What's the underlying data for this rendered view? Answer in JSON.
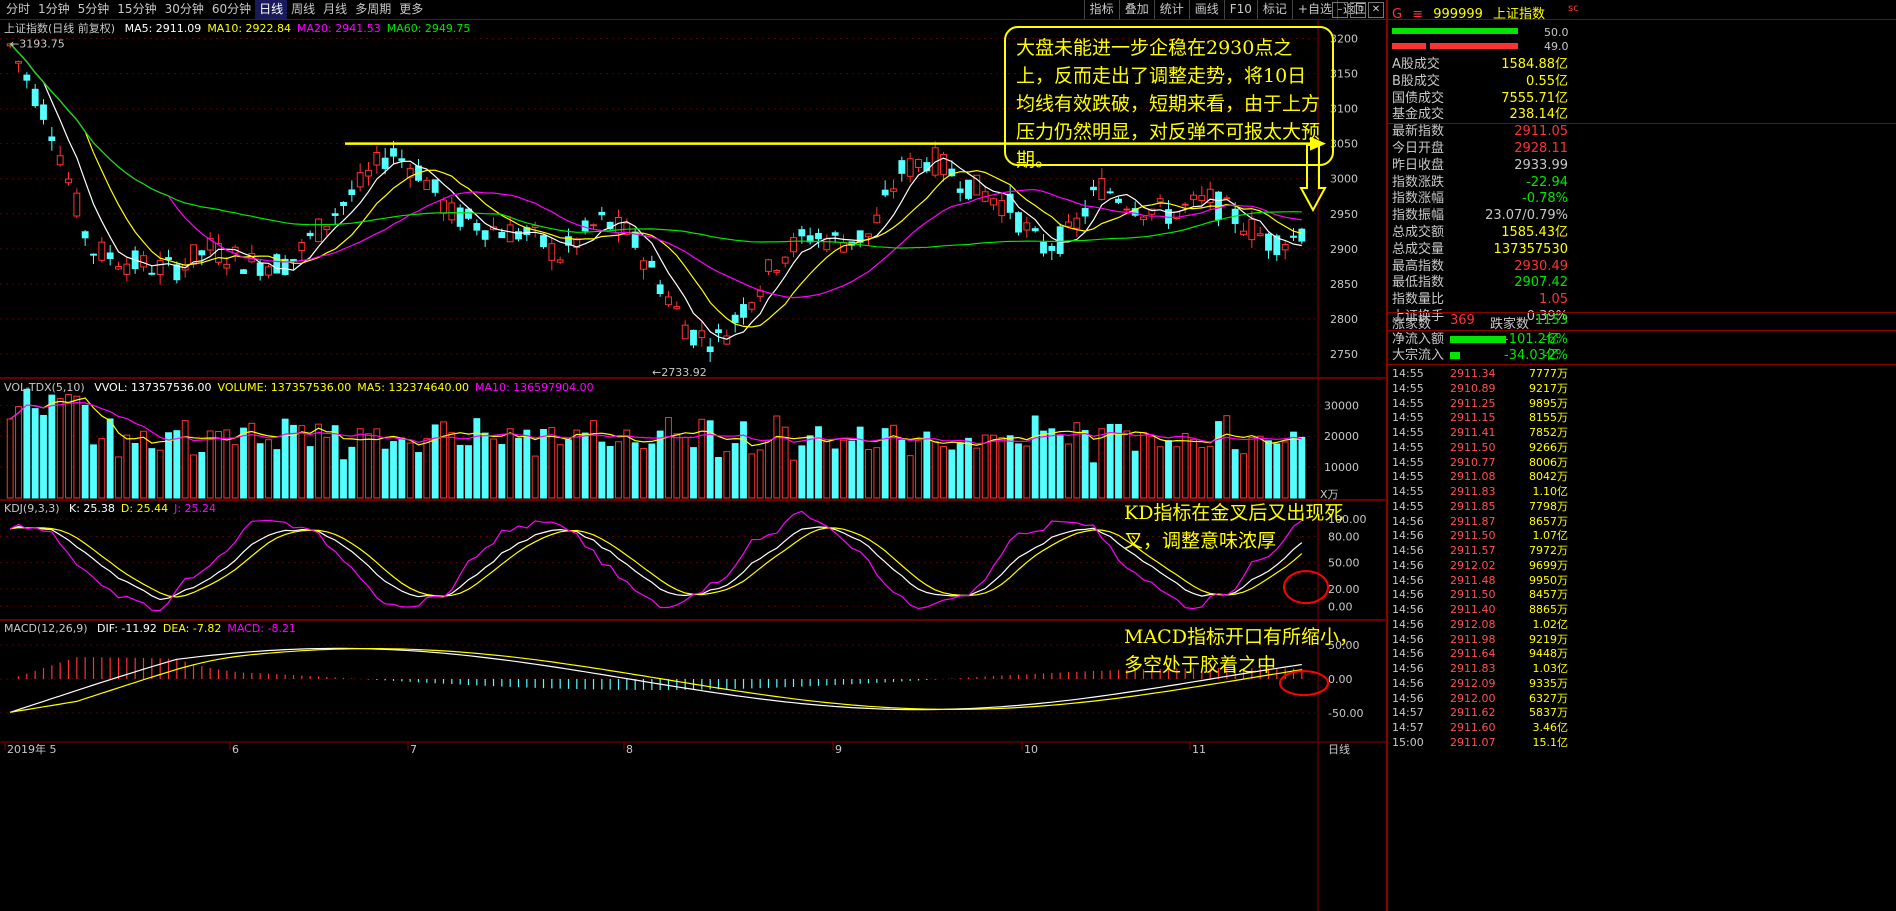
{
  "toolbar": {
    "periods": [
      "分时",
      "1分钟",
      "5分钟",
      "15分钟",
      "30分钟",
      "60分钟",
      "日线",
      "周线",
      "月线",
      "多周期",
      "更多"
    ],
    "active_period": "日线",
    "tools": [
      "指标",
      "叠加",
      "统计",
      "画线",
      "F10",
      "标记",
      "+自选",
      "返回"
    ]
  },
  "main": {
    "title": "上证指数(日线 前复权)",
    "ma": [
      {
        "label": "MA5: 2911.09",
        "color": "#ffffff"
      },
      {
        "label": "MA10: 2922.84",
        "color": "#ffff00"
      },
      {
        "label": "MA20: 2941.53",
        "color": "#ff00ff"
      },
      {
        "label": "MA60: 2949.75",
        "color": "#00e600"
      }
    ],
    "high_label": "3193.75",
    "low_label": "2733.92",
    "price_axis": [
      "3200",
      "3150",
      "3100",
      "3050",
      "3000",
      "2950",
      "2900",
      "2850",
      "2800",
      "2750"
    ]
  },
  "volume": {
    "label": "VOL-TDX(5,10)",
    "items": [
      {
        "label": "VVOL: 137357536.00",
        "color": "#ffffff"
      },
      {
        "label": "VOLUME: 137357536.00",
        "color": "#ffff00"
      },
      {
        "label": "MA5: 132374640.00",
        "color": "#ffff00"
      },
      {
        "label": "MA10: 136597904.00",
        "color": "#ff00ff"
      }
    ],
    "axis": [
      "30000",
      "20000",
      "10000"
    ],
    "unit": "X万"
  },
  "kdj": {
    "label": "KDJ(9,3,3)",
    "items": [
      {
        "label": "K: 25.38",
        "color": "#ffffff"
      },
      {
        "label": "D: 25.44",
        "color": "#ffff00"
      },
      {
        "label": "J: 25.24",
        "color": "#ff00ff"
      }
    ],
    "axis": [
      "100.00",
      "80.00",
      "50.00",
      "20.00",
      "0.00"
    ]
  },
  "macd": {
    "label": "MACD(12,26,9)",
    "items": [
      {
        "label": "DIF: -11.92",
        "color": "#ffffff"
      },
      {
        "label": "DEA: -7.82",
        "color": "#ffff00"
      },
      {
        "label": "MACD: -8.21",
        "color": "#ff00ff"
      }
    ],
    "axis": [
      "50.00",
      "0.00",
      "-50.00"
    ]
  },
  "annotations": {
    "callout": "大盘未能进一步企稳在2930点之上，反而走出了调整走势，将10日均线有效跌破，短期来看，由于上方压力仍然明显，对反弹不可报太大预期。",
    "kd_note_1": "KD指标在金叉后又出现死",
    "kd_note_2": "叉，调整意味浓厚",
    "macd_note_1": "MACD指标开口有所缩小，",
    "macd_note_2": "多空处于胶着之中"
  },
  "dates": [
    "2019年 5",
    "6",
    "7",
    "8",
    "9",
    "10",
    "11"
  ],
  "status_period": "日线",
  "sidebar": {
    "code": "999999",
    "name": "上证指数",
    "tag": "sc",
    "bar_values": [
      "50.0",
      "49.0"
    ],
    "quotes": [
      {
        "k": "A股成交",
        "v": "1584.88亿",
        "c": "#ffff00"
      },
      {
        "k": "B股成交",
        "v": "0.55亿",
        "c": "#ffff00"
      },
      {
        "k": "国债成交",
        "v": "7555.71亿",
        "c": "#ffff00"
      },
      {
        "k": "基金成交",
        "v": "238.14亿",
        "c": "#ffff00"
      },
      {
        "k": "最新指数",
        "v": "2911.05",
        "c": "#ff3232"
      },
      {
        "k": "今日开盘",
        "v": "2928.11",
        "c": "#ff3232"
      },
      {
        "k": "昨日收盘",
        "v": "2933.99",
        "c": "#c8c8c8"
      },
      {
        "k": "指数涨跌",
        "v": "-22.94",
        "c": "#00e600"
      },
      {
        "k": "指数涨幅",
        "v": "-0.78%",
        "c": "#00e600"
      },
      {
        "k": "指数振幅",
        "v": "23.07/0.79%",
        "c": "#c8c8c8"
      },
      {
        "k": "总成交额",
        "v": "1585.43亿",
        "c": "#ffff00"
      },
      {
        "k": "总成交量",
        "v": "137357530",
        "c": "#ffff00"
      },
      {
        "k": "最高指数",
        "v": "2930.49",
        "c": "#ff3232"
      },
      {
        "k": "最低指数",
        "v": "2907.42",
        "c": "#00e600"
      },
      {
        "k": "指数量比",
        "v": "1.05",
        "c": "#ff3232"
      },
      {
        "k": "上证换手",
        "v": "0.39%",
        "c": "#c8c8c8"
      }
    ],
    "rise_label": "涨家数",
    "rise_value": "369",
    "fall_label": "跌家数",
    "fall_value": "1153",
    "flow": [
      {
        "k": "净流入额",
        "v": "-101.2亿",
        "p": "-6%"
      },
      {
        "k": "大宗流入",
        "v": "-34.03亿",
        "p": "-2%"
      }
    ],
    "ticks": [
      {
        "t": "14:55",
        "p": "2911.34",
        "v": "7777万"
      },
      {
        "t": "14:55",
        "p": "2910.89",
        "v": "9217万"
      },
      {
        "t": "14:55",
        "p": "2911.25",
        "v": "9895万"
      },
      {
        "t": "14:55",
        "p": "2911.15",
        "v": "8155万"
      },
      {
        "t": "14:55",
        "p": "2911.41",
        "v": "7852万"
      },
      {
        "t": "14:55",
        "p": "2911.50",
        "v": "9266万"
      },
      {
        "t": "14:55",
        "p": "2910.77",
        "v": "8006万"
      },
      {
        "t": "14:55",
        "p": "2911.08",
        "v": "8042万"
      },
      {
        "t": "14:55",
        "p": "2911.83",
        "v": "1.10亿"
      },
      {
        "t": "14:55",
        "p": "2911.85",
        "v": "7798万"
      },
      {
        "t": "14:56",
        "p": "2911.87",
        "v": "8657万"
      },
      {
        "t": "14:56",
        "p": "2911.50",
        "v": "1.07亿"
      },
      {
        "t": "14:56",
        "p": "2911.57",
        "v": "7972万"
      },
      {
        "t": "14:56",
        "p": "2912.02",
        "v": "9699万"
      },
      {
        "t": "14:56",
        "p": "2911.48",
        "v": "9950万"
      },
      {
        "t": "14:56",
        "p": "2911.50",
        "v": "8457万"
      },
      {
        "t": "14:56",
        "p": "2911.40",
        "v": "8865万"
      },
      {
        "t": "14:56",
        "p": "2912.08",
        "v": "1.02亿"
      },
      {
        "t": "14:56",
        "p": "2911.98",
        "v": "9219万"
      },
      {
        "t": "14:56",
        "p": "2911.64",
        "v": "9448万"
      },
      {
        "t": "14:56",
        "p": "2911.83",
        "v": "1.03亿"
      },
      {
        "t": "14:56",
        "p": "2912.09",
        "v": "9335万"
      },
      {
        "t": "14:56",
        "p": "2912.00",
        "v": "6327万"
      },
      {
        "t": "14:57",
        "p": "2911.62",
        "v": "5837万"
      },
      {
        "t": "14:57",
        "p": "2911.60",
        "v": "3.46亿"
      },
      {
        "t": "15:00",
        "p": "2911.07",
        "v": "15.1亿"
      }
    ]
  }
}
